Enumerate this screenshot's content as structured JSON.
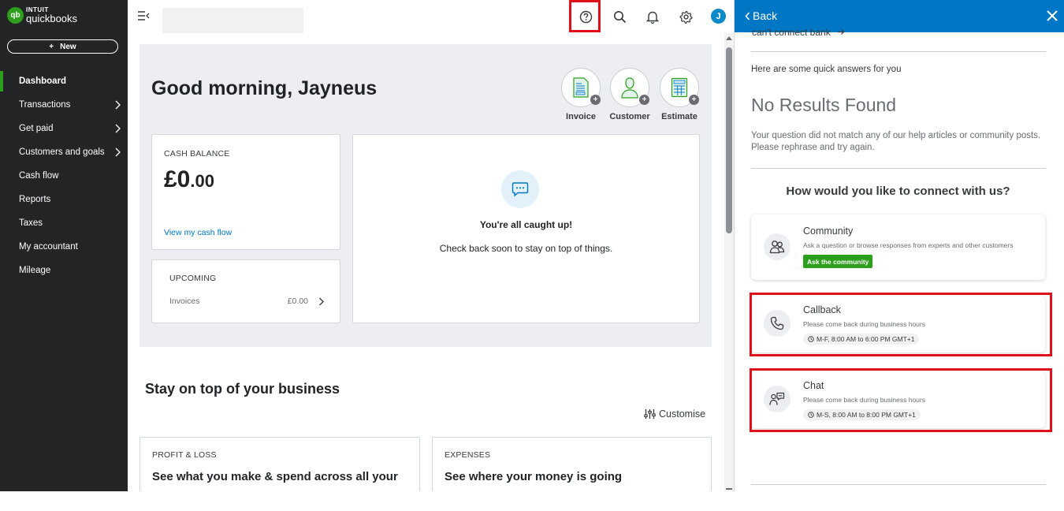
{
  "app": {
    "brand_top": "INTUIT",
    "brand_name": "quickbooks",
    "brand_mark": "qb",
    "accent_color": "#2ca01c",
    "header_blue": "#0077c5",
    "highlight_color": "#e0101b"
  },
  "sidebar": {
    "new_label": "New",
    "items": [
      {
        "label": "Dashboard",
        "active": true,
        "chevron": false
      },
      {
        "label": "Transactions",
        "active": false,
        "chevron": true
      },
      {
        "label": "Get paid",
        "active": false,
        "chevron": true
      },
      {
        "label": "Customers and goals",
        "active": false,
        "chevron": true
      },
      {
        "label": "Cash flow",
        "active": false,
        "chevron": false
      },
      {
        "label": "Reports",
        "active": false,
        "chevron": false
      },
      {
        "label": "Taxes",
        "active": false,
        "chevron": false
      },
      {
        "label": "My accountant",
        "active": false,
        "chevron": false
      },
      {
        "label": "Mileage",
        "active": false,
        "chevron": false
      }
    ]
  },
  "topbar": {
    "icons": [
      "help-icon",
      "search-icon",
      "bell-icon",
      "gear-icon"
    ],
    "avatar_initial": "J"
  },
  "dashboard": {
    "greeting": "Good morning, Jayneus",
    "quick_actions": [
      {
        "label": "Invoice",
        "icon": "invoice-icon"
      },
      {
        "label": "Customer",
        "icon": "customer-icon"
      },
      {
        "label": "Estimate",
        "icon": "estimate-icon"
      }
    ],
    "cash": {
      "label": "CASH BALANCE",
      "amount_main": "£0",
      "amount_cents": ".00",
      "link": "View my cash flow"
    },
    "upcoming": {
      "title": "UPCOMING",
      "row_label": "Invoices",
      "row_amount": "£0.00"
    },
    "caught_up": {
      "title": "You're all caught up!",
      "subtitle": "Check back soon to stay on top of things."
    },
    "section_title": "Stay on top of your business",
    "customise_label": "Customise",
    "business_cards": [
      {
        "label": "PROFIT & LOSS",
        "title": "See what you make & spend across all your"
      },
      {
        "label": "EXPENSES",
        "title": "See where your money is going"
      }
    ]
  },
  "help": {
    "back_label": "Back",
    "cut_off_text": "can't connect bank",
    "quick_answers": "Here are some quick answers for you",
    "no_results_title": "No Results Found",
    "no_results_message": "Your question did not match any of our help articles or community posts. Please rephrase and try again.",
    "connect_title": "How would you like to connect with us?",
    "options": {
      "community": {
        "title": "Community",
        "description": "Ask a question or browse responses from experts and other customers",
        "button": "Ask the community"
      },
      "callback": {
        "title": "Callback",
        "description": "Please come back during business hours",
        "hours": "M-F, 8:00 AM to 6:00 PM GMT+1"
      },
      "chat": {
        "title": "Chat",
        "description": "Please come back during business hours",
        "hours": "M-S, 8:00 AM to 8:00 PM GMT+1"
      }
    }
  }
}
